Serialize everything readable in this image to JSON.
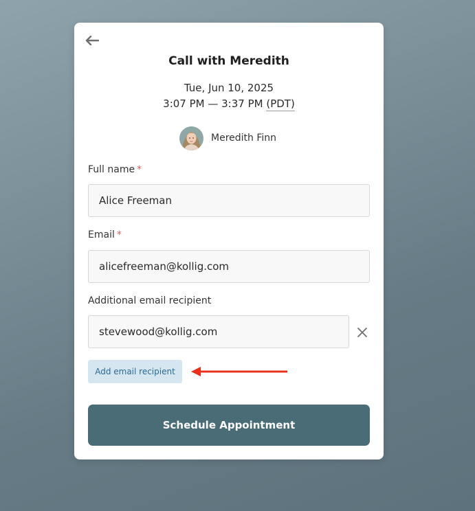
{
  "event": {
    "title": "Call with Meredith",
    "date": "Tue, Jun 10, 2025",
    "time_range": "3:07 PM — 3:37 PM",
    "timezone": "(PDT)"
  },
  "host": {
    "name": "Meredith Finn"
  },
  "form": {
    "full_name": {
      "label": "Full name",
      "required_mark": "*",
      "value": "Alice Freeman"
    },
    "email": {
      "label": "Email",
      "required_mark": "*",
      "value": "alicefreeman@kollig.com"
    },
    "additional_email": {
      "label": "Additional email recipient",
      "value": "stevewood@kollig.com"
    },
    "add_recipient_label": "Add email recipient",
    "submit_label": "Schedule Appointment"
  },
  "colors": {
    "primary_button": "#4a6c77",
    "add_button_bg": "#d5e6f0",
    "add_button_text": "#2a6a93",
    "required_mark": "#e35b5b",
    "annotation_arrow": "#e8301c"
  },
  "icons": {
    "back": "arrow-left-icon",
    "remove": "close-icon"
  }
}
